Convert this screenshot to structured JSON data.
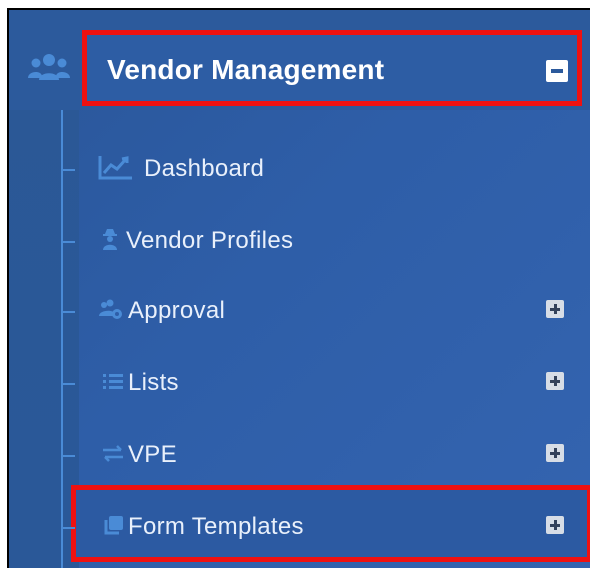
{
  "header": {
    "title": "Vendor Management",
    "icon": "users-icon",
    "toggle": "collapse"
  },
  "menu": {
    "items": [
      {
        "label": "Dashboard",
        "icon": "chart-line-icon",
        "expandable": false
      },
      {
        "label": "Vendor Profiles",
        "icon": "user-secret-icon",
        "expandable": false
      },
      {
        "label": "Approval",
        "icon": "users-cog-icon",
        "expandable": true
      },
      {
        "label": "Lists",
        "icon": "list-icon",
        "expandable": true
      },
      {
        "label": "VPE",
        "icon": "exchange-icon",
        "expandable": true
      },
      {
        "label": "Form Templates",
        "icon": "clone-icon",
        "expandable": true
      }
    ]
  },
  "colors": {
    "panel": "#2e5ea8",
    "header": "#2c5a9c",
    "highlight_border": "#ee1111",
    "icon_blue": "#4a8bd6",
    "text": "#e9f0fb"
  }
}
